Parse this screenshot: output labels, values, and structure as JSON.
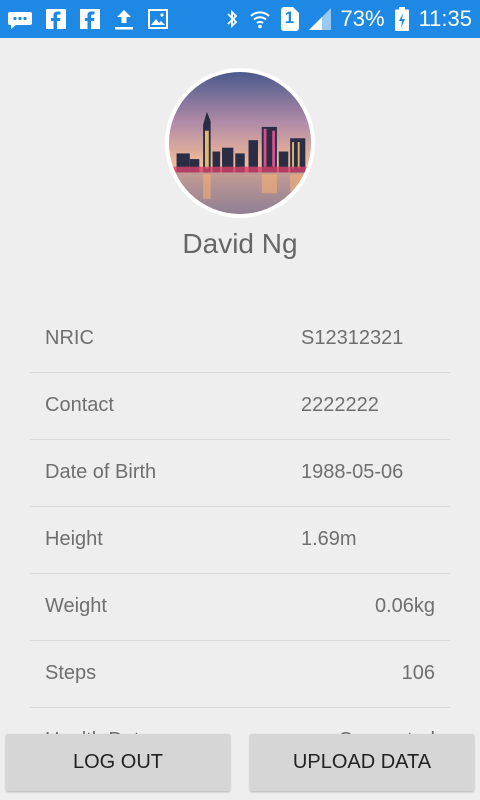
{
  "status_bar": {
    "battery_percent": "73%",
    "time": "11:35",
    "sim_slot": "1",
    "icons": [
      "chat-icon",
      "facebook-icon",
      "facebook-icon",
      "upload-icon",
      "image-icon",
      "bluetooth-icon",
      "wifi-icon",
      "sim-icon",
      "signal-icon",
      "battery-charging-icon"
    ]
  },
  "profile": {
    "name": "David Ng"
  },
  "details": [
    {
      "label": "NRIC",
      "value": "S12312321"
    },
    {
      "label": "Contact",
      "value": "2222222"
    },
    {
      "label": "Date of Birth",
      "value": "1988-05-06"
    },
    {
      "label": "Height",
      "value": "1.69m"
    },
    {
      "label": "Weight",
      "value": "0.06kg"
    },
    {
      "label": "Steps",
      "value": "106"
    },
    {
      "label": "Health Data",
      "value": "Connected"
    }
  ],
  "buttons": {
    "logout": "LOG OUT",
    "upload": "UPLOAD DATA"
  },
  "colors": {
    "status_bar": "#1e88e5",
    "background": "#eeeeee",
    "button": "#d6d6d6"
  }
}
